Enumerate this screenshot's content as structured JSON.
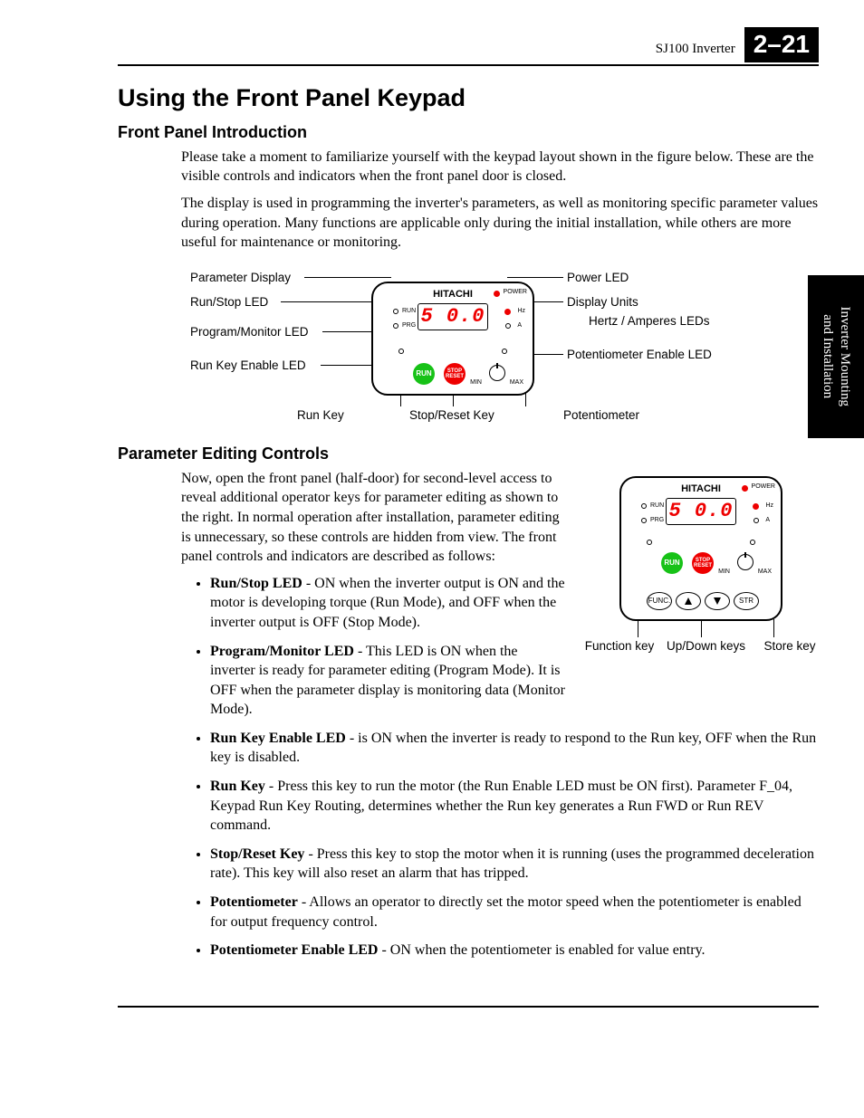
{
  "header": {
    "doc_id": "SJ100 Inverter",
    "page_num": "2–21"
  },
  "side_tab": {
    "line1": "Inverter Mounting",
    "line2": "and Installation"
  },
  "title": "Using the Front Panel Keypad",
  "intro": {
    "heading": "Front Panel Introduction",
    "p1": "Please take a moment to familiarize yourself with the keypad layout shown in the figure below. These are the visible controls and indicators when the front panel door is closed.",
    "p2": "The display is used in programming the inverter's parameters, as well as monitoring specific parameter values during operation. Many functions are applicable only during the initial installation, while others are more useful for maintenance or monitoring."
  },
  "fig_callouts": {
    "left": [
      "Parameter Display",
      "Run/Stop LED",
      "Program/Monitor LED",
      "Run Key Enable LED"
    ],
    "bottom": [
      "Run Key",
      "Stop/Reset Key",
      "Potentiometer"
    ],
    "right": [
      "Power LED",
      "Display Units",
      "Hertz / Amperes LEDs",
      "Potentiometer Enable LED"
    ]
  },
  "keypad": {
    "brand": "HITACHI",
    "power": "POWER",
    "readout": "5 0.0",
    "run": "RUN",
    "prg": "PRG",
    "hz": "Hz",
    "a": "A",
    "run_btn": "RUN",
    "stop_btn_l1": "STOP",
    "stop_btn_l2": "RESET",
    "min": "MIN",
    "max": "MAX",
    "func": "FUNC.",
    "str": "STR"
  },
  "edit": {
    "heading": "Parameter Editing Controls",
    "p1": "Now, open the front panel (half-door) for second-level access to reveal additional operator keys for parameter editing as shown to the right. In normal operation after installation, parameter editing is unnecessary, so these controls are hidden from view. The front panel controls and indicators are described as follows:"
  },
  "fig2_labels": {
    "func": "Function key",
    "updown": "Up/Down keys",
    "store": "Store key"
  },
  "bullets": [
    {
      "term": "Run/Stop LED",
      "text": " - ON when the inverter output is ON and the motor is developing torque (Run Mode), and OFF when the inverter output is OFF (Stop Mode)."
    },
    {
      "term": "Program/Monitor LED",
      "text": " - This LED is ON when the inverter is ready for parameter editing (Program Mode). It is OFF when the parameter display is monitoring data (Monitor Mode)."
    },
    {
      "term": "Run Key Enable LED",
      "text": " - is ON when the inverter is ready to respond to the Run key, OFF when the Run key is disabled."
    },
    {
      "term": "Run Key",
      "text": " - Press this key to run the motor (the Run Enable LED must be ON first). Parameter F_04, Keypad Run Key Routing, determines whether the Run key generates a Run FWD or Run REV command."
    },
    {
      "term": "Stop/Reset Key",
      "text": " - Press this key to stop the motor when it is running (uses the programmed deceleration rate). This key will also reset an alarm that has tripped."
    },
    {
      "term": "Potentiometer",
      "text": " - Allows an operator to directly set the motor speed when the potentiometer is enabled for output frequency control."
    },
    {
      "term": "Potentiometer Enable LED",
      "text": " - ON when the potentiometer is enabled for value entry."
    }
  ]
}
